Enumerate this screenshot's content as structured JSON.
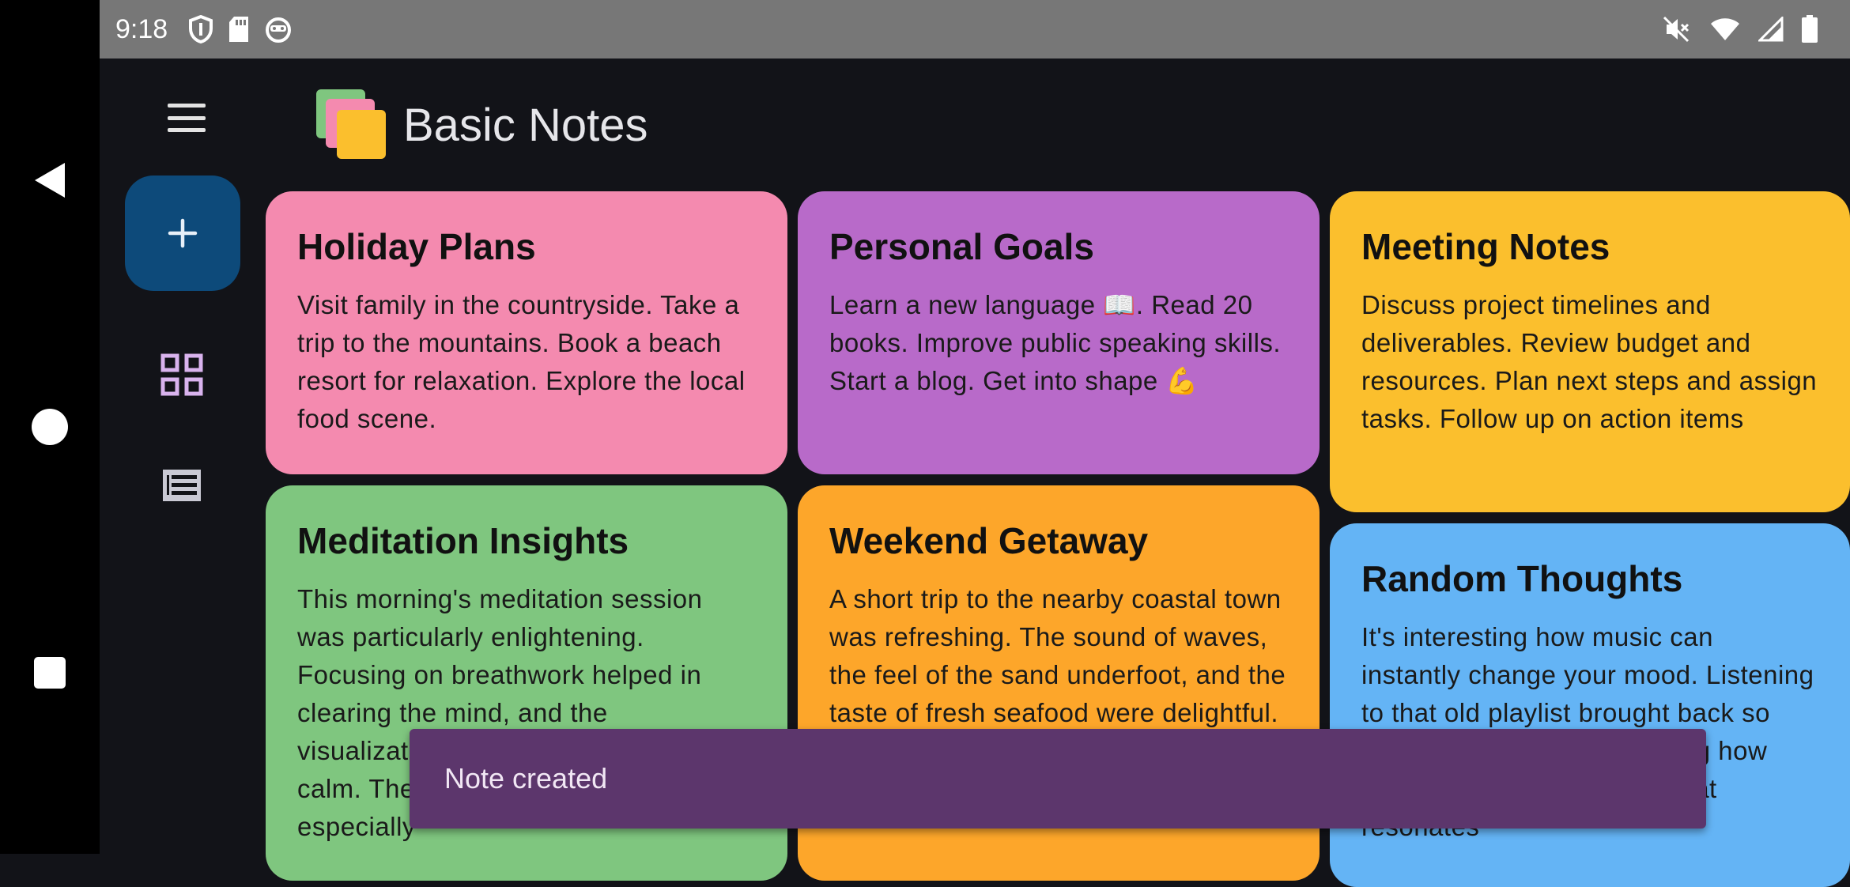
{
  "status_bar": {
    "time": "9:18",
    "left_icons": [
      "shield-icon",
      "sd-card-icon",
      "android-face-icon"
    ],
    "right_icons": [
      "mute-icon",
      "wifi-icon",
      "cell-signal-icon",
      "battery-icon"
    ]
  },
  "nav": {
    "buttons": [
      "back-icon",
      "home-icon",
      "recents-icon"
    ]
  },
  "rail": {
    "menu_icon": "hamburger-menu-icon",
    "fab_icon": "plus-icon",
    "grid_view_icon": "grid-view-icon",
    "list_view_icon": "list-view-icon",
    "fab_color": "#0d4a7a",
    "grid_icon_color": "#d9b3ee"
  },
  "header": {
    "title": "Basic Notes",
    "logo_icon": "stacked-notes-logo"
  },
  "notes": [
    {
      "title": "Holiday Plans",
      "body": "Visit family in the countryside. Take a trip to the mountains. Book a beach resort for relaxation. Explore the local food scene.",
      "color": "#f48aaf"
    },
    {
      "title": "Personal Goals",
      "body": "Learn a new language 📖. Read 20 books. Improve public speaking skills. Start a blog. Get into shape 💪",
      "color": "#b86ac9"
    },
    {
      "title": "Meeting Notes",
      "body": "Discuss project timelines and deliverables. Review budget and resources. Plan next steps and assign tasks. Follow up on action items",
      "color": "#fbbf2d"
    },
    {
      "title": "Meditation Insights",
      "body": "This morning's meditation session was particularly enlightening. Focusing on breathwork helped in clearing the mind, and the visualization brought a deep sense of calm. The mantra 'Let go' was especially",
      "color": "#7fc67f"
    },
    {
      "title": "Weekend Getaway",
      "body": "A short trip to the nearby coastal town was refreshing. The sound of waves, the feel of the sand underfoot, and the taste of fresh seafood were delightful. The views from the lighthouse were",
      "color": "#fda62a"
    },
    {
      "title": "Random Thoughts",
      "body": "It's interesting how music can instantly change your mood. Listening to that old playlist brought back so many memories. It's amazing how those melodies and lyrics that resonates",
      "color": "#64b4f5"
    }
  ],
  "snackbar": {
    "text": "Note created",
    "color": "#5c366c"
  }
}
